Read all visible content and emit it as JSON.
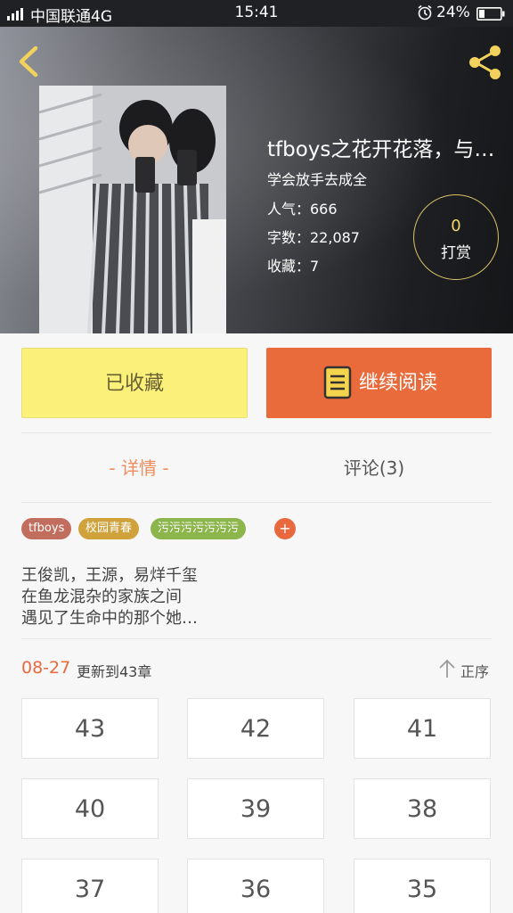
{
  "status_bar": {
    "carrier": "中国联通4G",
    "time": "15:41",
    "battery": "24%"
  },
  "book": {
    "title": "tfboys之花开花落，与…",
    "subtitle": "学会放手去成全",
    "popularity": "人气：666",
    "word_count": "字数：22,087",
    "favorites": "收藏：7",
    "tip_count": "0",
    "tip_label": "打赏"
  },
  "actions": {
    "favorited_label": "已收藏",
    "continue_label": "继续阅读"
  },
  "tabs": {
    "detail": "- 详情 -",
    "comments": "评论(3)"
  },
  "tags": [
    "tfboys",
    "校园青春",
    "污污污污污污污",
    "+"
  ],
  "summary": [
    "王俊凯，王源，易烊千玺",
    "在鱼龙混杂的家族之间",
    "遇见了生命中的那个她…"
  ],
  "update": {
    "date": "08-27",
    "text": "更新到43章",
    "sort_label": "正序"
  },
  "chapters": [
    "43",
    "42",
    "41",
    "40",
    "39",
    "38",
    "37",
    "36",
    "35"
  ],
  "colors": {
    "accent": "#e9693f",
    "favorite_button": "#fbf07a",
    "tip_ring": "#d8c36a",
    "tag_1": "#c26e5f",
    "tag_2": "#cfa23c",
    "tag_3": "#8cb54c"
  }
}
